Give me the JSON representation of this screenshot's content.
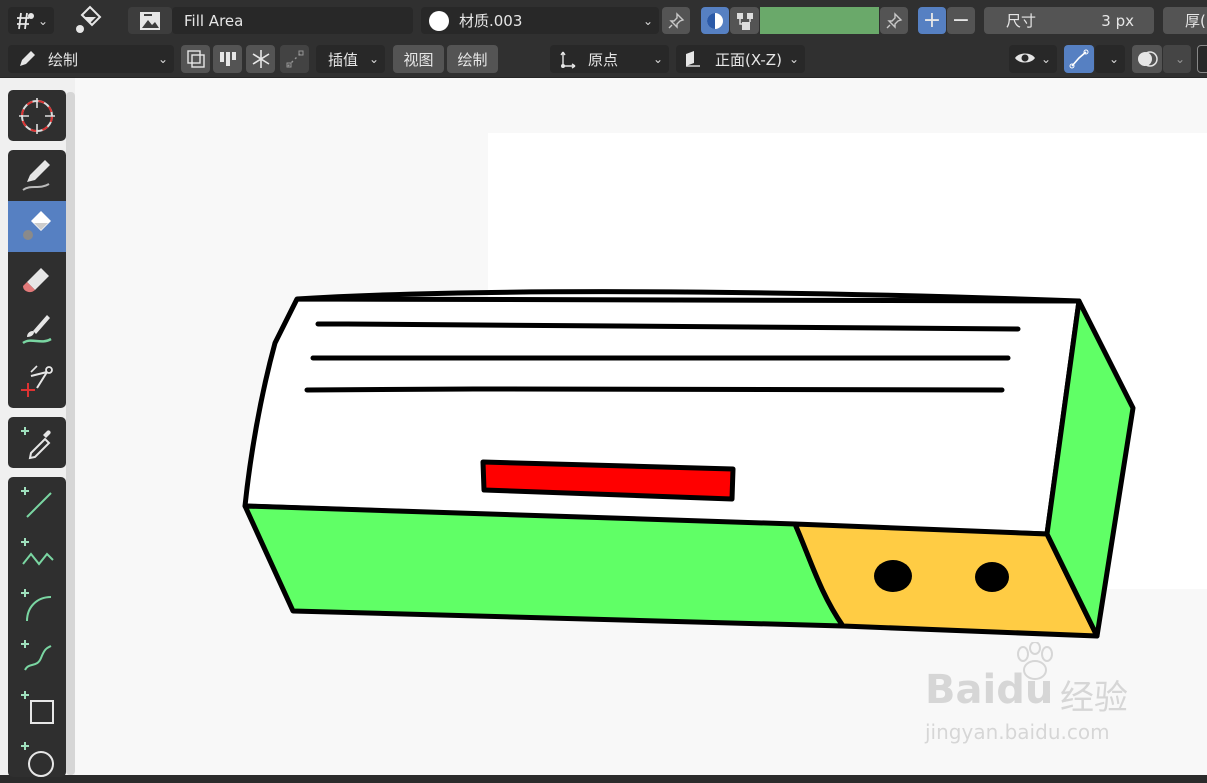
{
  "header": {
    "tool_name": "Fill Area",
    "material_name": "材质.003",
    "size_label": "尺寸",
    "size_value": "3 px",
    "thickness_label": "厚(",
    "fill_color": "#6aa96a"
  },
  "subheader": {
    "mode": "绘制",
    "interpolate": "插值",
    "view_menu": "视图",
    "draw_menu": "绘制",
    "origin": "原点",
    "orientation": "正面(X-Z)"
  },
  "toolbar": {
    "tools": [
      {
        "name": "cursor",
        "icon": "cursor-icon"
      },
      {
        "name": "draw",
        "icon": "pencil-icon"
      },
      {
        "name": "fill",
        "icon": "paint-bucket-icon",
        "active": true
      },
      {
        "name": "erase",
        "icon": "eraser-icon"
      },
      {
        "name": "tint",
        "icon": "brush-icon"
      },
      {
        "name": "cutter",
        "icon": "scissors-icon"
      },
      {
        "name": "eyedropper",
        "icon": "eyedropper-icon"
      },
      {
        "name": "line",
        "icon": "line-icon"
      },
      {
        "name": "polyline",
        "icon": "polyline-icon"
      },
      {
        "name": "arc",
        "icon": "arc-icon"
      },
      {
        "name": "curve",
        "icon": "curve-icon"
      },
      {
        "name": "box",
        "icon": "box-icon"
      },
      {
        "name": "circle",
        "icon": "circle-icon"
      }
    ]
  },
  "drawing": {
    "colors": {
      "outline": "#000000",
      "body": "#ffffff",
      "panel": "#60ff66",
      "vent": "#ffcc44",
      "indicator": "#ff0000",
      "side": "#60ff66"
    }
  },
  "watermark": {
    "brand": "Baidu",
    "brand_suffix": "经验",
    "url": "jingyan.baidu.com"
  }
}
